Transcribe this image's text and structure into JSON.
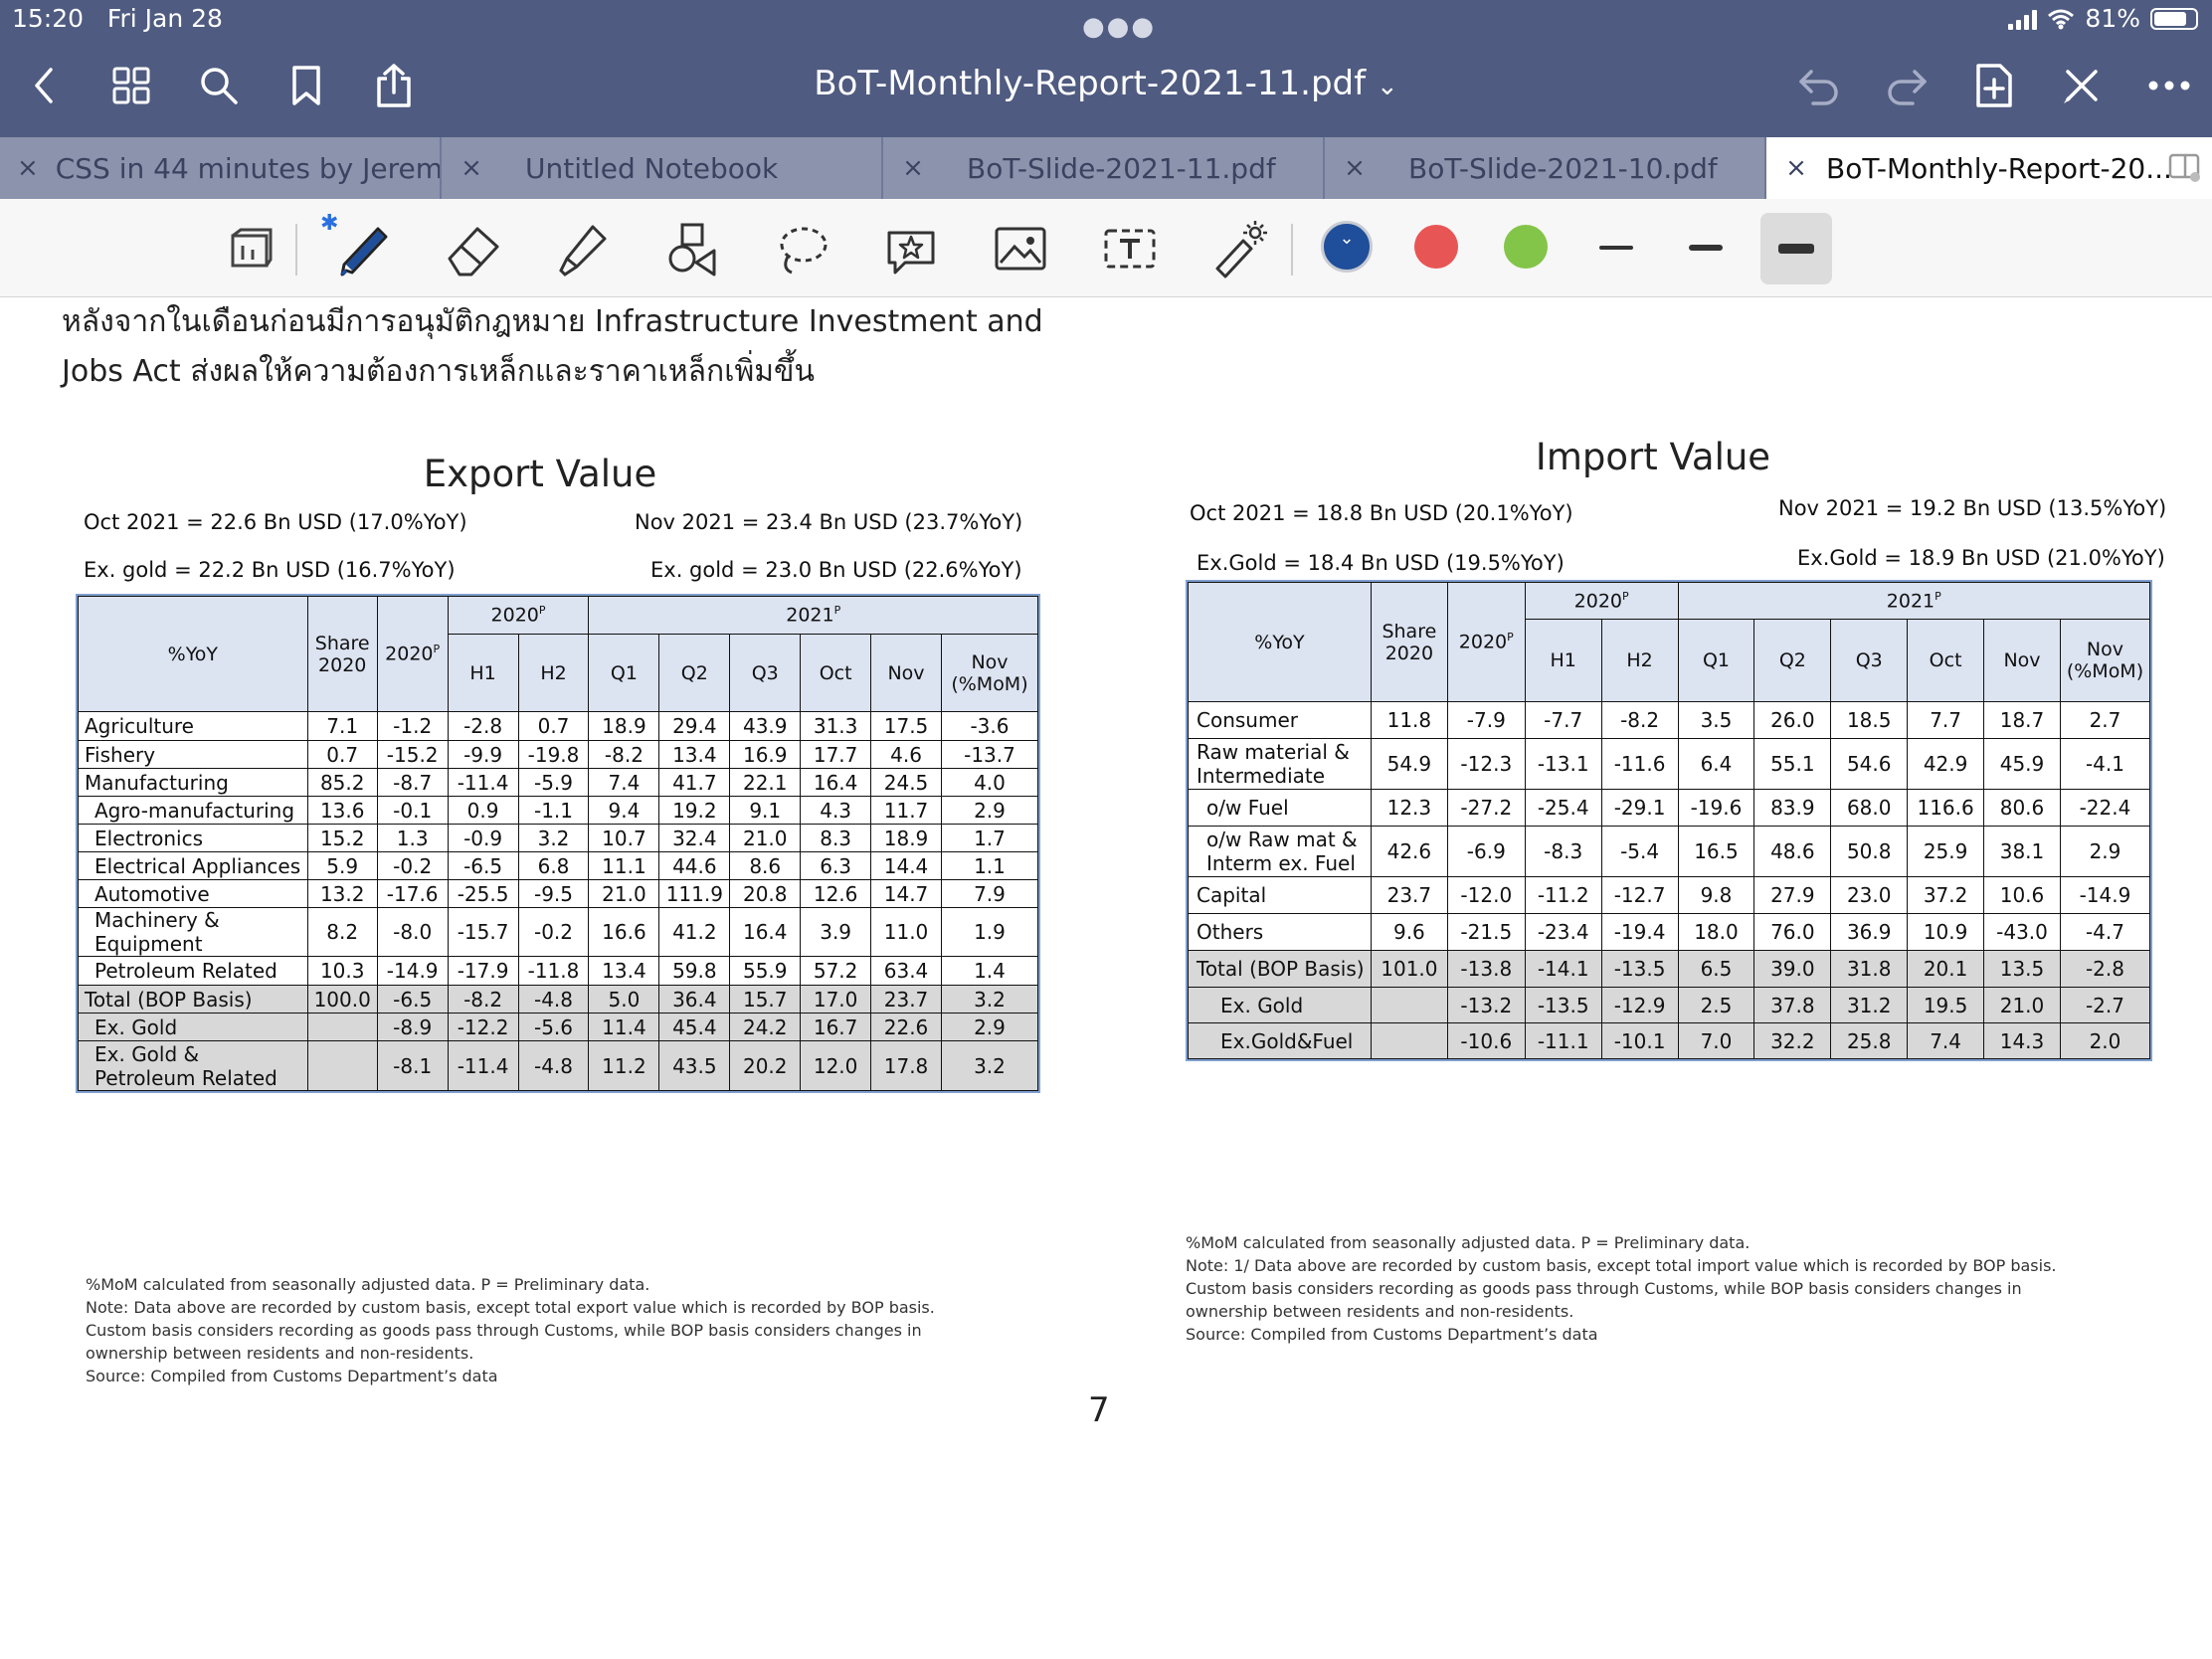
{
  "status": {
    "time": "15:20",
    "date": "Fri Jan 28",
    "battery": "81%",
    "battery_level": 0.81
  },
  "title_bar": {
    "title": "BoT-Monthly-Report-2021-11.pdf",
    "chevron": "⌄"
  },
  "tabs": [
    {
      "label": "CSS in 44 minutes by Jerem...",
      "close": "×"
    },
    {
      "label": "Untitled Notebook",
      "close": "×"
    },
    {
      "label": "BoT-Slide-2021-11.pdf",
      "close": "×"
    },
    {
      "label": "BoT-Slide-2021-10.pdf",
      "close": "×"
    },
    {
      "label": "BoT-Monthly-Report-20...",
      "close": "×"
    }
  ],
  "toolbar": {
    "bluetooth": "✱",
    "colors": {
      "selected": "#1f4e9a",
      "red": "#e85555",
      "green": "#83c548"
    },
    "selected_chevron": "⌄"
  },
  "doc": {
    "intro_line1": "หลังจากในเดือนก่อนมีการอนุมัติกฎหมาย Infrastructure Investment and",
    "intro_line2": "Jobs Act ส่งผลให้ความต้องการเหล็กและราคาเหล็กเพิ่มขึ้น",
    "page_number": "7"
  },
  "export": {
    "title": "Export Value",
    "sum_oct": "Oct 2021 = 22.6 Bn USD (17.0%YoY)",
    "sum_nov": "Nov 2021 = 23.4 Bn USD (23.7%YoY)",
    "sum_exg_oct": "Ex. gold = 22.2 Bn USD (16.7%YoY)",
    "sum_exg_nov": "Ex. gold = 23.0 Bn USD (22.6%YoY)",
    "hdr": {
      "yoy": "%YoY",
      "share1": "Share",
      "share2": "2020",
      "y2020": "2020",
      "p": "P",
      "y2021": "2021",
      "h1": "H1",
      "h2": "H2",
      "q1": "Q1",
      "q2": "Q2",
      "q3": "Q3",
      "oct": "Oct",
      "nov": "Nov",
      "nov1": "Nov",
      "nov2": "(%MoM)"
    },
    "rows": [
      {
        "label": "Agriculture",
        "v": [
          "7.1",
          "-1.2",
          "-2.8",
          "0.7",
          "18.9",
          "29.4",
          "43.9",
          "31.3",
          "17.5",
          "-3.6"
        ]
      },
      {
        "label": "Fishery",
        "v": [
          "0.7",
          "-15.2",
          "-9.9",
          "-19.8",
          "-8.2",
          "13.4",
          "16.9",
          "17.7",
          "4.6",
          "-13.7"
        ]
      },
      {
        "label": "Manufacturing",
        "v": [
          "85.2",
          "-8.7",
          "-11.4",
          "-5.9",
          "7.4",
          "41.7",
          "22.1",
          "16.4",
          "24.5",
          "4.0"
        ]
      },
      {
        "label": "Agro-manufacturing",
        "v": [
          "13.6",
          "-0.1",
          "0.9",
          "-1.1",
          "9.4",
          "19.2",
          "9.1",
          "4.3",
          "11.7",
          "2.9"
        ]
      },
      {
        "label": "Electronics",
        "v": [
          "15.2",
          "1.3",
          "-0.9",
          "3.2",
          "10.7",
          "32.4",
          "21.0",
          "8.3",
          "18.9",
          "1.7"
        ]
      },
      {
        "label": "Electrical Appliances",
        "v": [
          "5.9",
          "-0.2",
          "-6.5",
          "6.8",
          "11.1",
          "44.6",
          "8.6",
          "6.3",
          "14.4",
          "1.1"
        ]
      },
      {
        "label": "Automotive",
        "v": [
          "13.2",
          "-17.6",
          "-25.5",
          "-9.5",
          "21.0",
          "111.9",
          "20.8",
          "12.6",
          "14.7",
          "7.9"
        ]
      },
      {
        "label": "Machinery &",
        "label2": "Equipment",
        "v": [
          "8.2",
          "-8.0",
          "-15.7",
          "-0.2",
          "16.6",
          "41.2",
          "16.4",
          "3.9",
          "11.0",
          "1.9"
        ]
      },
      {
        "label": "Petroleum Related",
        "v": [
          "10.3",
          "-14.9",
          "-17.9",
          "-11.8",
          "13.4",
          "59.8",
          "55.9",
          "57.2",
          "63.4",
          "1.4"
        ]
      },
      {
        "label": "Total (BOP Basis)",
        "v": [
          "100.0",
          "-6.5",
          "-8.2",
          "-4.8",
          "5.0",
          "36.4",
          "15.7",
          "17.0",
          "23.7",
          "3.2"
        ]
      },
      {
        "label": "Ex. Gold",
        "v": [
          "",
          "-8.9",
          "-12.2",
          "-5.6",
          "11.4",
          "45.4",
          "24.2",
          "16.7",
          "22.6",
          "2.9"
        ]
      },
      {
        "label": "Ex. Gold &",
        "label2": "Petroleum Related",
        "v": [
          "",
          "-8.1",
          "-11.4",
          "-4.8",
          "11.2",
          "43.5",
          "20.2",
          "12.0",
          "17.8",
          "3.2"
        ]
      }
    ],
    "notes": [
      "%MoM calculated from seasonally adjusted data.    P = Preliminary data.",
      "Note: Data above are recorded by custom basis, except total export value which is recorded by BOP basis.",
      "Custom basis considers recording as goods pass through Customs, while BOP basis considers changes in",
      "ownership between residents and non-residents.",
      "Source: Compiled from Customs Department’s data"
    ]
  },
  "import": {
    "title": "Import Value",
    "sum_oct": "Oct 2021 =  18.8 Bn USD (20.1%YoY)",
    "sum_nov": "Nov 2021 =  19.2 Bn USD (13.5%YoY)",
    "sum_exg_oct": "Ex.Gold =  18.4 Bn USD (19.5%YoY)",
    "sum_exg_nov": "Ex.Gold =  18.9 Bn USD (21.0%YoY)",
    "hdr": {
      "yoy": "%YoY",
      "share1": "Share",
      "share2": "2020",
      "y2020": "2020",
      "p": "P",
      "y2021": "2021",
      "h1": "H1",
      "h2": "H2",
      "q1": "Q1",
      "q2": "Q2",
      "q3": "Q3",
      "oct": "Oct",
      "nov": "Nov",
      "nov1": "Nov",
      "nov2": "(%MoM)"
    },
    "rows": [
      {
        "label": "Consumer",
        "v": [
          "11.8",
          "-7.9",
          "-7.7",
          "-8.2",
          "3.5",
          "26.0",
          "18.5",
          "7.7",
          "18.7",
          "2.7"
        ]
      },
      {
        "label": "Raw material &",
        "label2": "Intermediate",
        "v": [
          "54.9",
          "-12.3",
          "-13.1",
          "-11.6",
          "6.4",
          "55.1",
          "54.6",
          "42.9",
          "45.9",
          "-4.1"
        ]
      },
      {
        "label": "o/w Fuel",
        "v": [
          "12.3",
          "-27.2",
          "-25.4",
          "-29.1",
          "-19.6",
          "83.9",
          "68.0",
          "116.6",
          "80.6",
          "-22.4"
        ]
      },
      {
        "label": "o/w Raw mat &",
        "label2": "Interm ex. Fuel",
        "v": [
          "42.6",
          "-6.9",
          "-8.3",
          "-5.4",
          "16.5",
          "48.6",
          "50.8",
          "25.9",
          "38.1",
          "2.9"
        ]
      },
      {
        "label": "Capital",
        "v": [
          "23.7",
          "-12.0",
          "-11.2",
          "-12.7",
          "9.8",
          "27.9",
          "23.0",
          "37.2",
          "10.6",
          "-14.9"
        ]
      },
      {
        "label": "Others",
        "v": [
          "9.6",
          "-21.5",
          "-23.4",
          "-19.4",
          "18.0",
          "76.0",
          "36.9",
          "10.9",
          "-43.0",
          "-4.7"
        ]
      },
      {
        "label": "Total (BOP Basis)",
        "v": [
          "101.0",
          "-13.8",
          "-14.1",
          "-13.5",
          "6.5",
          "39.0",
          "31.8",
          "20.1",
          "13.5",
          "-2.8"
        ]
      },
      {
        "label": "Ex. Gold",
        "v": [
          "",
          "-13.2",
          "-13.5",
          "-12.9",
          "2.5",
          "37.8",
          "31.2",
          "19.5",
          "21.0",
          "-2.7"
        ]
      },
      {
        "label": "Ex.Gold&Fuel",
        "v": [
          "",
          "-10.6",
          "-11.1",
          "-10.1",
          "7.0",
          "32.2",
          "25.8",
          "7.4",
          "14.3",
          "2.0"
        ]
      }
    ],
    "notes": [
      "%MoM calculated from seasonally adjusted data.    P = Preliminary data.",
      "Note: 1/ Data above are recorded by custom basis, except total import value which is recorded by BOP basis.",
      "Custom basis considers recording as goods pass through Customs, while BOP basis considers changes in",
      "ownership between residents and non-residents.",
      "Source: Compiled from Customs Department’s data"
    ]
  }
}
